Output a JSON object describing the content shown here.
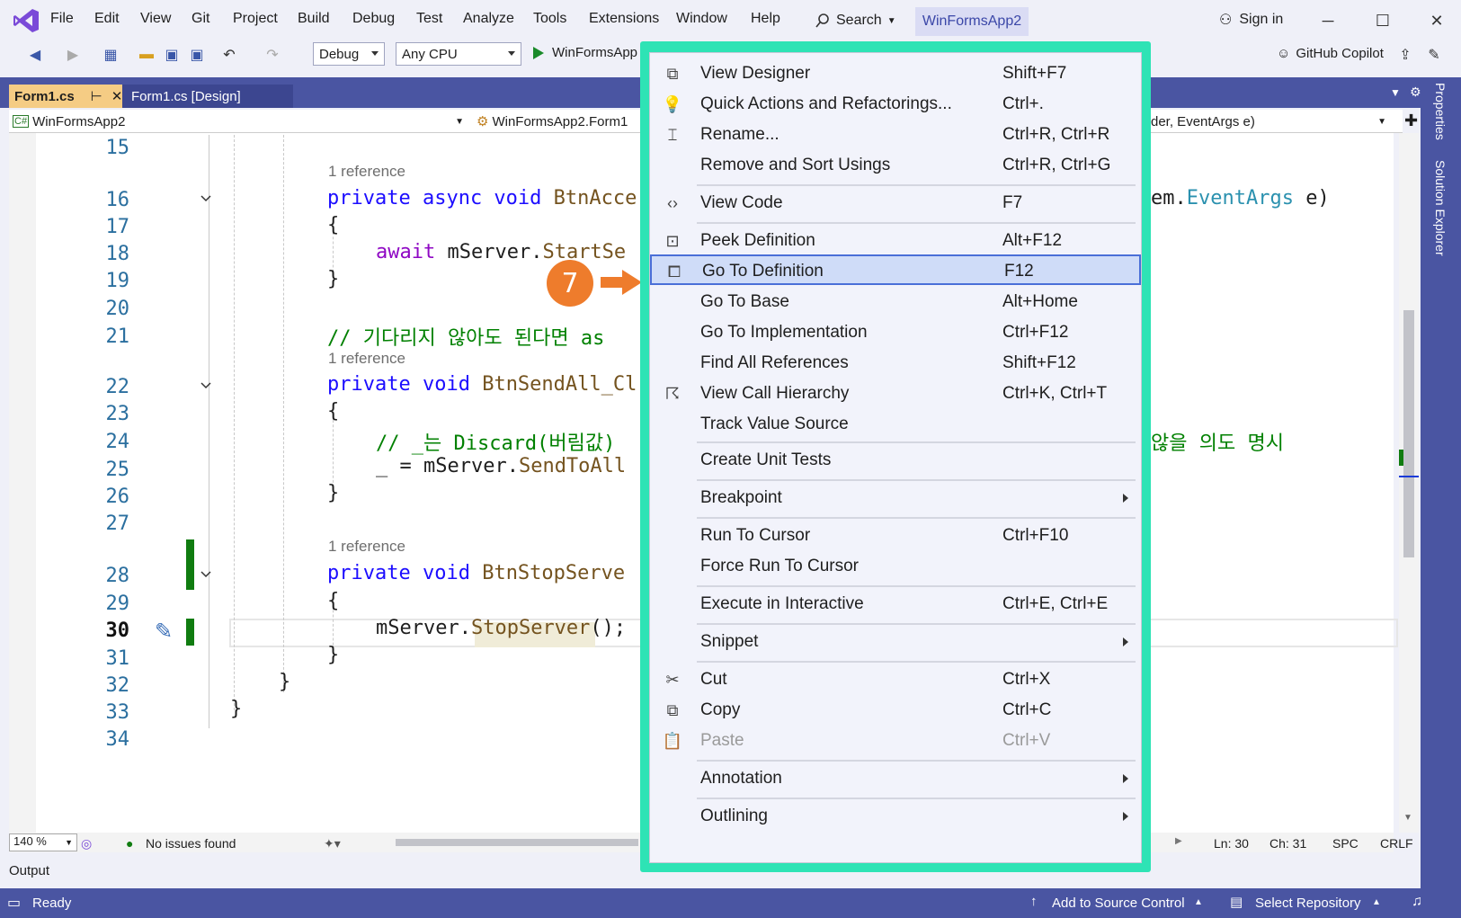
{
  "menubar": {
    "items": [
      "File",
      "Edit",
      "View",
      "Git",
      "Project",
      "Build",
      "Debug",
      "Test",
      "Analyze",
      "Tools",
      "Extensions",
      "Window",
      "Help"
    ],
    "search_label": "Search",
    "solution_tab": "WinFormsApp2",
    "sign_in": "Sign in"
  },
  "toolbar": {
    "config": "Debug",
    "platform": "Any CPU",
    "run_target": "WinFormsApp",
    "copilot": "GitHub Copilot"
  },
  "tabs": {
    "active": "Form1.cs",
    "second": "Form1.cs [Design]"
  },
  "navbar": {
    "project": "WinFormsApp2",
    "class": "WinFormsApp2.Form1",
    "member": "der, EventArgs e)"
  },
  "editor": {
    "line_numbers": [
      "15",
      "16",
      "17",
      "18",
      "19",
      "20",
      "21",
      "22",
      "23",
      "24",
      "25",
      "26",
      "27",
      "28",
      "29",
      "30",
      "31",
      "32",
      "33",
      "34"
    ],
    "ref1": "1 reference",
    "ref2": "1 reference",
    "ref3": "1 reference",
    "l16_kw": "private async void",
    "l16_name": " BtnAcce",
    "l16_tail_type": "EventArgs",
    "l16_tail_pre": "em.",
    "l16_tail_post": " e)",
    "l17": "{",
    "l18_kw": "await",
    "l18_code": " mServer.",
    "l18_method": "StartSe",
    "l19": "}",
    "l21_comment": "// 기다리지 않아도 된다면 as",
    "l22_kw": "private void",
    "l22_name": " BtnSendAll_Cl",
    "l23": "{",
    "l24_comment": "// _는 Discard(버림값)",
    "l24_tail": "않을 의도 명시",
    "l25_code": "_ = mServer.",
    "l25_method": "SendToAll",
    "l26": "}",
    "l28_kw": "private void",
    "l28_name": " BtnStopServe",
    "l29": "{",
    "l30_code": "mServer.",
    "l30_method": "StopServer",
    "l30_end": "();",
    "l31": "}",
    "l32": "}",
    "l33": "}"
  },
  "edstatus": {
    "zoom": "140 %",
    "issues": "No issues found",
    "ln": "Ln: 30",
    "ch": "Ch: 31",
    "spc": "SPC",
    "crlf": "CRLF"
  },
  "output_title": "Output",
  "statusbar": {
    "ready": "Ready",
    "source_control": "Add to Source Control",
    "repo": "Select Repository"
  },
  "side": {
    "properties": "Properties",
    "solution_explorer": "Solution Explorer"
  },
  "callout_number": "7",
  "context_menu": [
    {
      "label": "View Designer",
      "shortcut": "Shift+F7",
      "icon": "view-designer-icon"
    },
    {
      "label": "Quick Actions and Refactorings...",
      "shortcut": "Ctrl+.",
      "icon": "lightbulb-icon"
    },
    {
      "label": "Rename...",
      "shortcut": "Ctrl+R, Ctrl+R",
      "icon": "rename-icon"
    },
    {
      "label": "Remove and Sort Usings",
      "shortcut": "Ctrl+R, Ctrl+G",
      "icon": ""
    },
    {
      "label": "View Code",
      "shortcut": "F7",
      "icon": "code-icon"
    },
    {
      "label": "Peek Definition",
      "shortcut": "Alt+F12",
      "icon": "peek-icon"
    },
    {
      "label": "Go To Definition",
      "shortcut": "F12",
      "icon": "goto-definition-icon"
    },
    {
      "label": "Go To Base",
      "shortcut": "Alt+Home",
      "icon": ""
    },
    {
      "label": "Go To Implementation",
      "shortcut": "Ctrl+F12",
      "icon": ""
    },
    {
      "label": "Find All References",
      "shortcut": "Shift+F12",
      "icon": ""
    },
    {
      "label": "View Call Hierarchy",
      "shortcut": "Ctrl+K, Ctrl+T",
      "icon": "call-hierarchy-icon"
    },
    {
      "label": "Track Value Source",
      "shortcut": "",
      "icon": ""
    },
    {
      "label": "Create Unit Tests",
      "shortcut": "",
      "icon": ""
    },
    {
      "label": "Breakpoint",
      "shortcut": "",
      "icon": ""
    },
    {
      "label": "Run To Cursor",
      "shortcut": "Ctrl+F10",
      "icon": ""
    },
    {
      "label": "Force Run To Cursor",
      "shortcut": "",
      "icon": ""
    },
    {
      "label": "Execute in Interactive",
      "shortcut": "Ctrl+E, Ctrl+E",
      "icon": ""
    },
    {
      "label": "Snippet",
      "shortcut": "",
      "icon": ""
    },
    {
      "label": "Cut",
      "shortcut": "Ctrl+X",
      "icon": "scissors-icon"
    },
    {
      "label": "Copy",
      "shortcut": "Ctrl+C",
      "icon": "copy-icon"
    },
    {
      "label": "Paste",
      "shortcut": "Ctrl+V",
      "icon": "paste-icon"
    },
    {
      "label": "Annotation",
      "shortcut": "",
      "icon": ""
    },
    {
      "label": "Outlining",
      "shortcut": "",
      "icon": ""
    }
  ]
}
